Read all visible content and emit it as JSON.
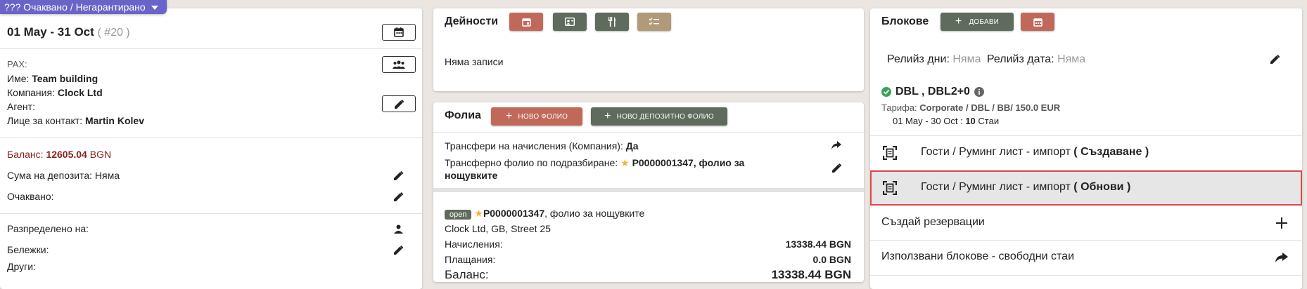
{
  "status": {
    "label": "??? Очаквано / Негарантирано"
  },
  "left": {
    "date_range": "01 May - 31 Oct",
    "ref": "( #20 )",
    "pax_label": "PAX:",
    "name_label": "Име:",
    "name_value": "Team building",
    "company_label": "Компания:",
    "company_value": "Clock Ltd",
    "agent_label": "Агент:",
    "contact_label": "Лице за контакт:",
    "contact_value": "Martin Kolev",
    "balance_label": "Баланс:",
    "balance_value": "12605.04",
    "balance_currency": "BGN",
    "deposit_label": "Сума на депозита: Няма",
    "expected_label": "Очаквано:",
    "distributed_label": "Разпределено на:",
    "notes_label": "Бележки:",
    "others_label": "Други:"
  },
  "activities": {
    "title": "Дейности",
    "empty": "Няма записи"
  },
  "folios": {
    "title": "Фолиа",
    "new_folio": "НОВО ФОЛИО",
    "new_deposit_folio": "НОВО ДЕПОЗИТНО ФОЛИО",
    "transfers_label": "Трансфери на начисления (Компания):",
    "transfers_value": "Да",
    "default_label": "Трансферно фолио по подразбиране:",
    "default_value_1": "P0000001347, фолио за",
    "default_value_2": "нощувките",
    "folio_status": "open",
    "folio_id": "P0000001347",
    "folio_desc": ", фолио за нощувките",
    "folio_address": "Clock Ltd, GB, Street 25",
    "charges_label": "Начисления:",
    "charges_value": "13338.44 BGN",
    "payments_label": "Плащания:",
    "payments_value": "0.0 BGN",
    "balance_label": "Баланс:",
    "balance_value": "13338.44 BGN"
  },
  "blocks": {
    "title": "Блокове",
    "add_label": "ДОБАВИ",
    "release_days_label": "Релийз дни:",
    "release_days_value": "Няма",
    "release_date_label": "Релийз дата:",
    "release_date_value": "Няма",
    "room_type": "DBL , DBL2+0",
    "tariff_label": "Тарифа:",
    "tariff_value": "Corporate / DBL / BB/ 150.0 EUR",
    "period": "01 May - 30 Oct :",
    "rooms_count": "10",
    "rooms_label": "Стаи",
    "import_create_pre": "Гости / Руминг лист - импорт",
    "import_create_action": "( Създаване )",
    "import_update_pre": "Гости / Руминг лист - импорт",
    "import_update_action": "( Обнови )",
    "create_reservations": "Създай резервации",
    "used_blocks": "Използвани блокове - свободни стаи"
  }
}
